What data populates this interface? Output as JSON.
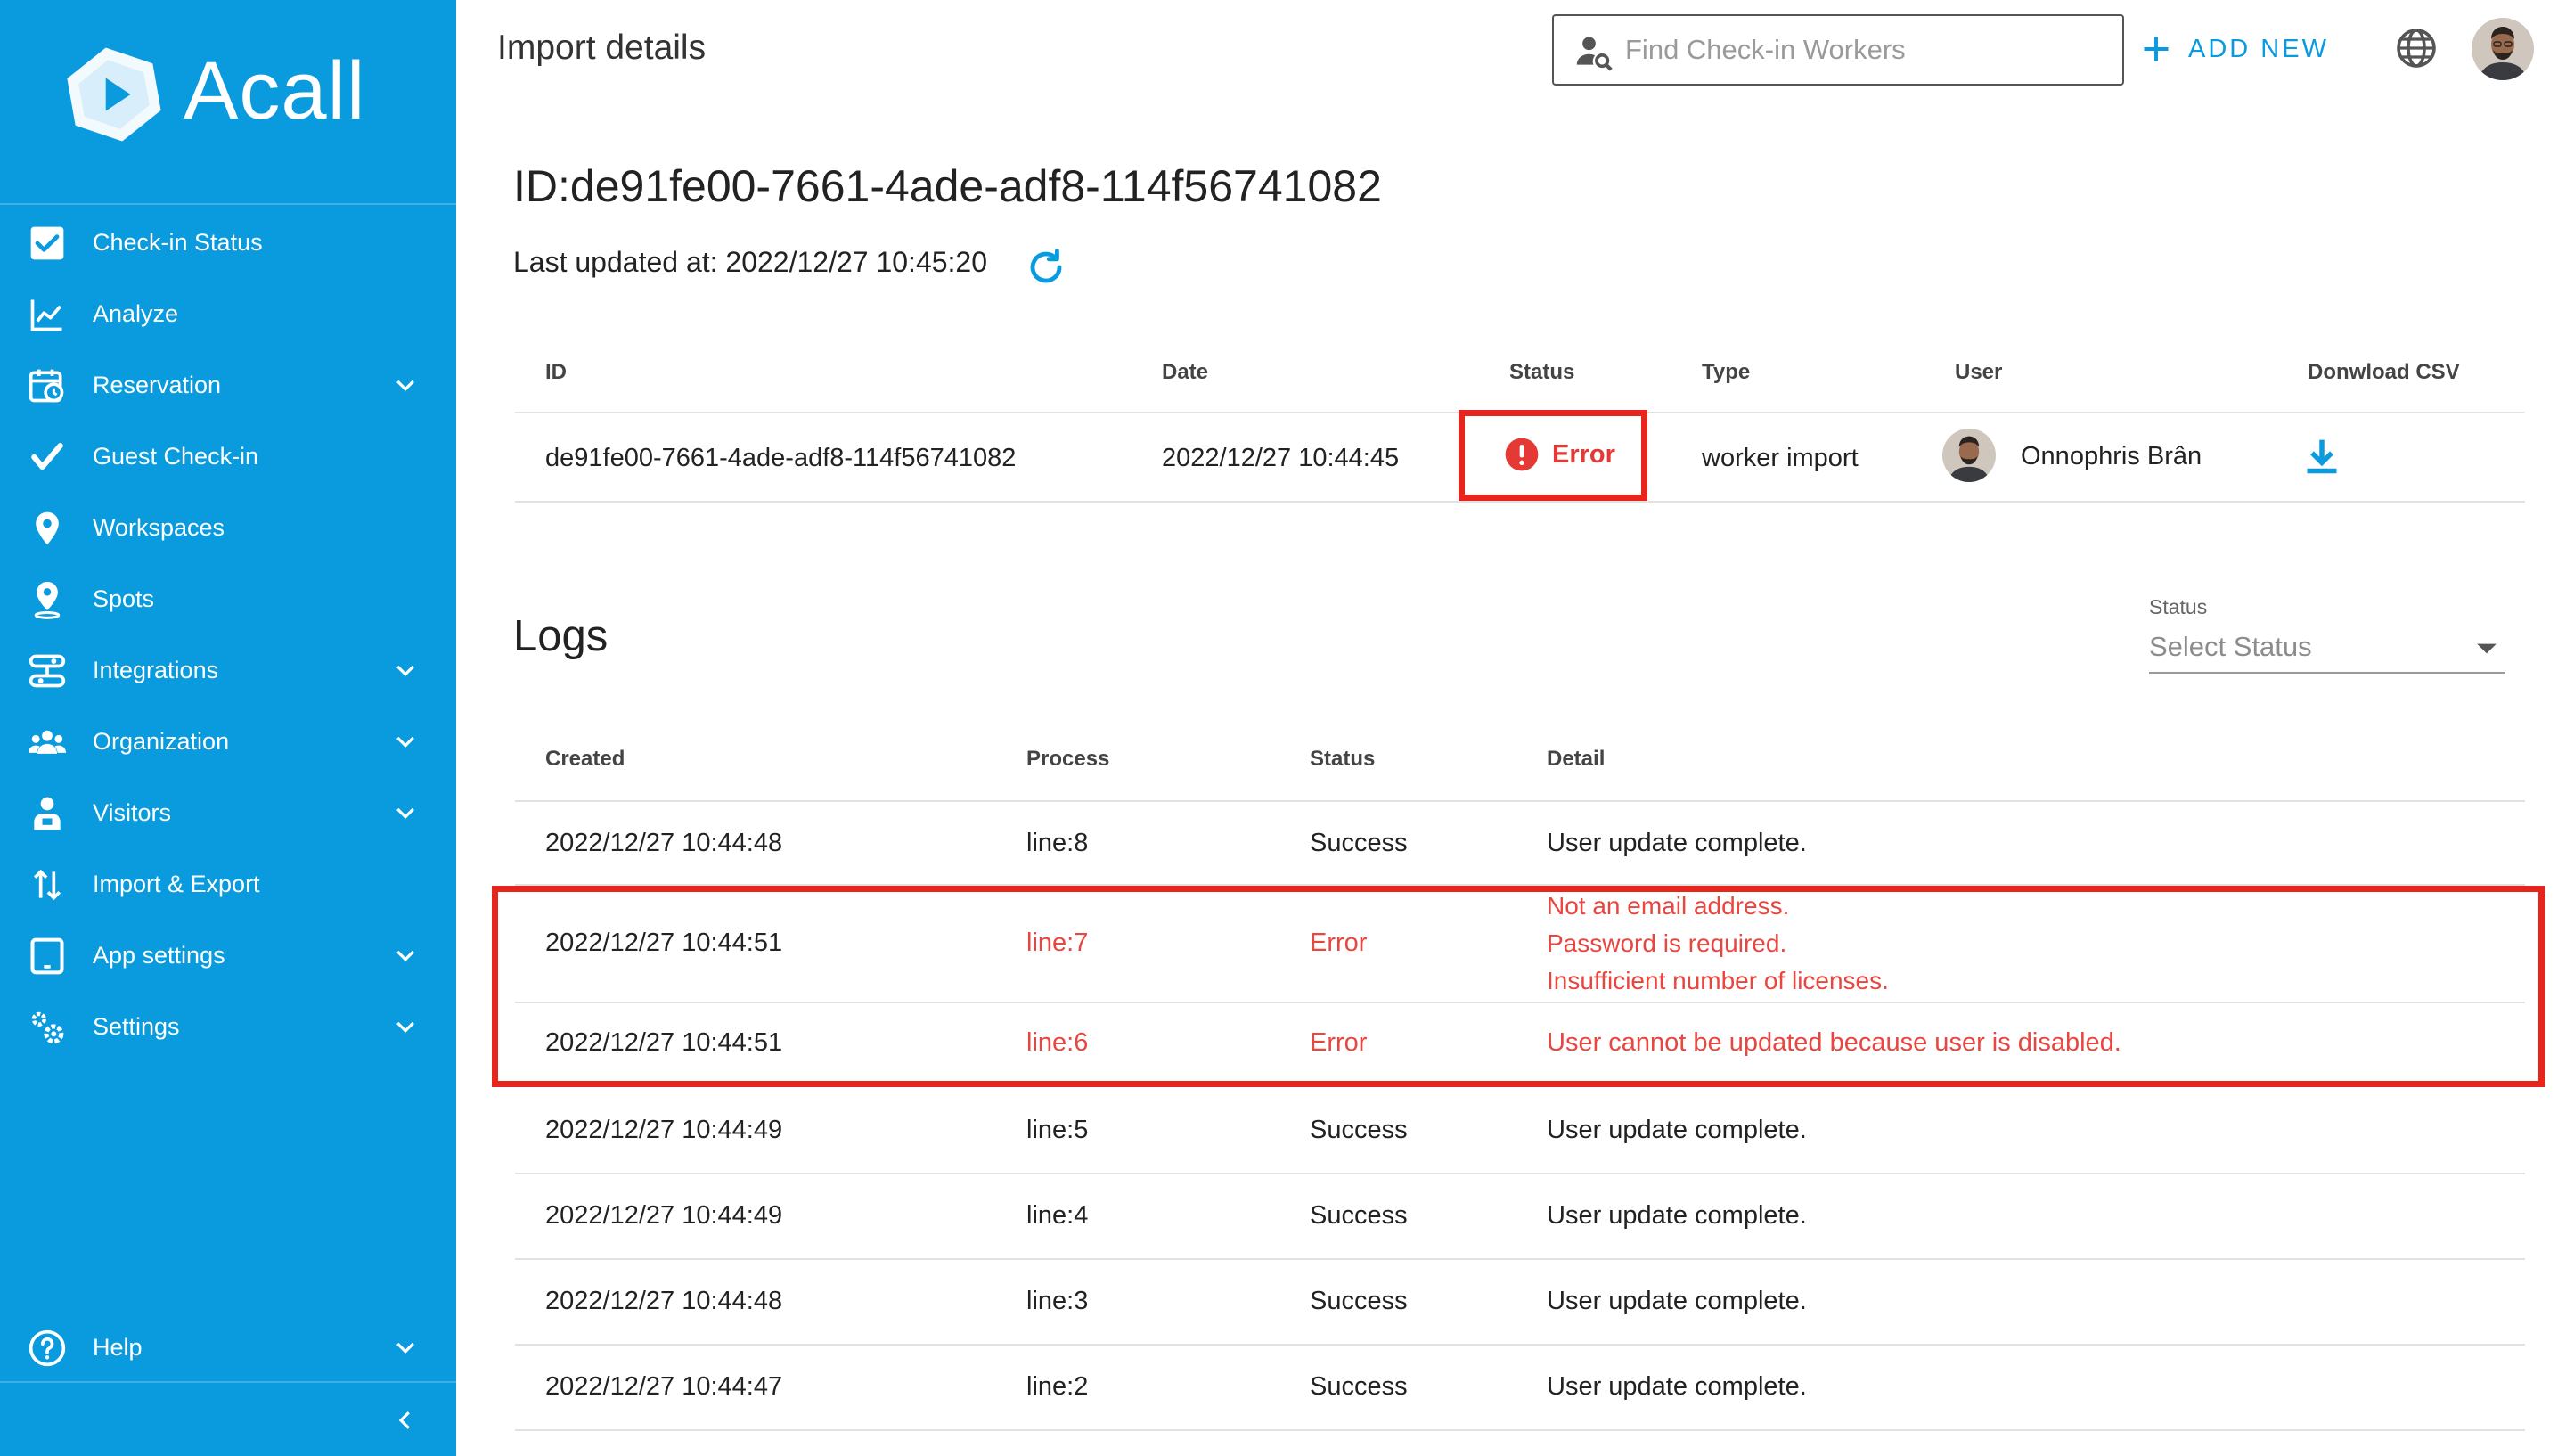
{
  "sidebar": {
    "brand": "Acall",
    "items": [
      {
        "label": "Check-in Status"
      },
      {
        "label": "Analyze"
      },
      {
        "label": "Reservation"
      },
      {
        "label": "Guest Check-in"
      },
      {
        "label": "Workspaces"
      },
      {
        "label": "Spots"
      },
      {
        "label": "Integrations"
      },
      {
        "label": "Organization"
      },
      {
        "label": "Visitors"
      },
      {
        "label": "Import & Export"
      },
      {
        "label": "App settings"
      },
      {
        "label": "Settings"
      },
      {
        "label": "Help"
      }
    ]
  },
  "header": {
    "title": "Import details",
    "search_placeholder": "Find Check-in Workers",
    "add_new": "ADD NEW"
  },
  "import": {
    "id_heading": "ID:de91fe00-7661-4ade-adf8-114f56741082",
    "last_updated": "Last updated at: 2022/12/27 10:45:20",
    "columns": [
      "ID",
      "Date",
      "Status",
      "Type",
      "User",
      "Donwload CSV"
    ],
    "row": {
      "id": "de91fe00-7661-4ade-adf8-114f56741082",
      "date": "2022/12/27 10:44:45",
      "status": "Error",
      "type": "worker import",
      "user": "Onnophris Brân"
    }
  },
  "logs": {
    "title": "Logs",
    "filter_label": "Status",
    "filter_placeholder": "Select Status",
    "columns": [
      "Created",
      "Process",
      "Status",
      "Detail"
    ],
    "rows": [
      {
        "created": "2022/12/27 10:44:48",
        "process": "line:8",
        "status": "Success",
        "detail": "User update complete."
      },
      {
        "created": "2022/12/27 10:44:51",
        "process": "line:7",
        "status": "Error",
        "detail_lines": [
          "Not an email address.",
          "Password is required.",
          "Insufficient number of licenses."
        ]
      },
      {
        "created": "2022/12/27 10:44:51",
        "process": "line:6",
        "status": "Error",
        "detail": "User cannot be updated because user is disabled."
      },
      {
        "created": "2022/12/27 10:44:49",
        "process": "line:5",
        "status": "Success",
        "detail": "User update complete."
      },
      {
        "created": "2022/12/27 10:44:49",
        "process": "line:4",
        "status": "Success",
        "detail": "User update complete."
      },
      {
        "created": "2022/12/27 10:44:48",
        "process": "line:3",
        "status": "Success",
        "detail": "User update complete."
      },
      {
        "created": "2022/12/27 10:44:47",
        "process": "line:2",
        "status": "Success",
        "detail": "User update complete."
      }
    ]
  },
  "colors": {
    "sidebar": "#0a9ade",
    "accent": "#0a9ade",
    "error": "#e8463f",
    "highlight": "#e8251d"
  }
}
